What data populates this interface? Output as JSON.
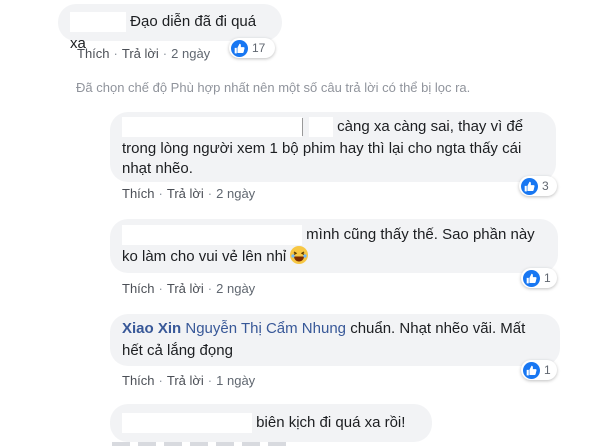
{
  "comments": [
    {
      "text": "Đạo diễn đã đi quá xa",
      "like_label": "Thích",
      "reply_label": "Trả lời",
      "time": "2 ngày",
      "reactions": "17",
      "reaction_icon": "like-icon"
    },
    {
      "text_lines": [
        "càng xa càng sai, thay vì để",
        "trong lòng người xem 1 bộ phim hay thì lại cho ngta thấy cái",
        "nhạt nhẽo."
      ],
      "like_label": "Thích",
      "reply_label": "Trả lời",
      "time": "2 ngày",
      "reactions": "3",
      "reaction_icon": "like-icon"
    },
    {
      "text_lines": [
        "mình cũng thấy thế. Sao phần này",
        "ko làm cho vui vẻ lên nhỉ"
      ],
      "emoji": "laughing-face-icon",
      "like_label": "Thích",
      "reply_label": "Trả lời",
      "time": "2 ngày",
      "reactions": "1",
      "reaction_icon": "like-icon"
    },
    {
      "author": "Xiao Xin",
      "mention": "Nguyễn Thị Cẩm Nhung",
      "text_line1": "chuẩn. Nhạt nhẽo vãi. Mất",
      "text_line2": "hết cả lắng đọng",
      "like_label": "Thích",
      "reply_label": "Trả lời",
      "time": "1 ngày",
      "reactions": "1",
      "reaction_icon": "like-icon"
    },
    {
      "text": "biên kịch đi quá xa rồi!"
    }
  ],
  "filter_notice": "Đã chọn chế độ Phù hợp nhất nên một số câu trả lời có thể bị lọc ra.",
  "colors": {
    "bubble": "#f2f3f5",
    "name": "#385898",
    "like_blue": "#1877f2",
    "meta": "#606770"
  }
}
